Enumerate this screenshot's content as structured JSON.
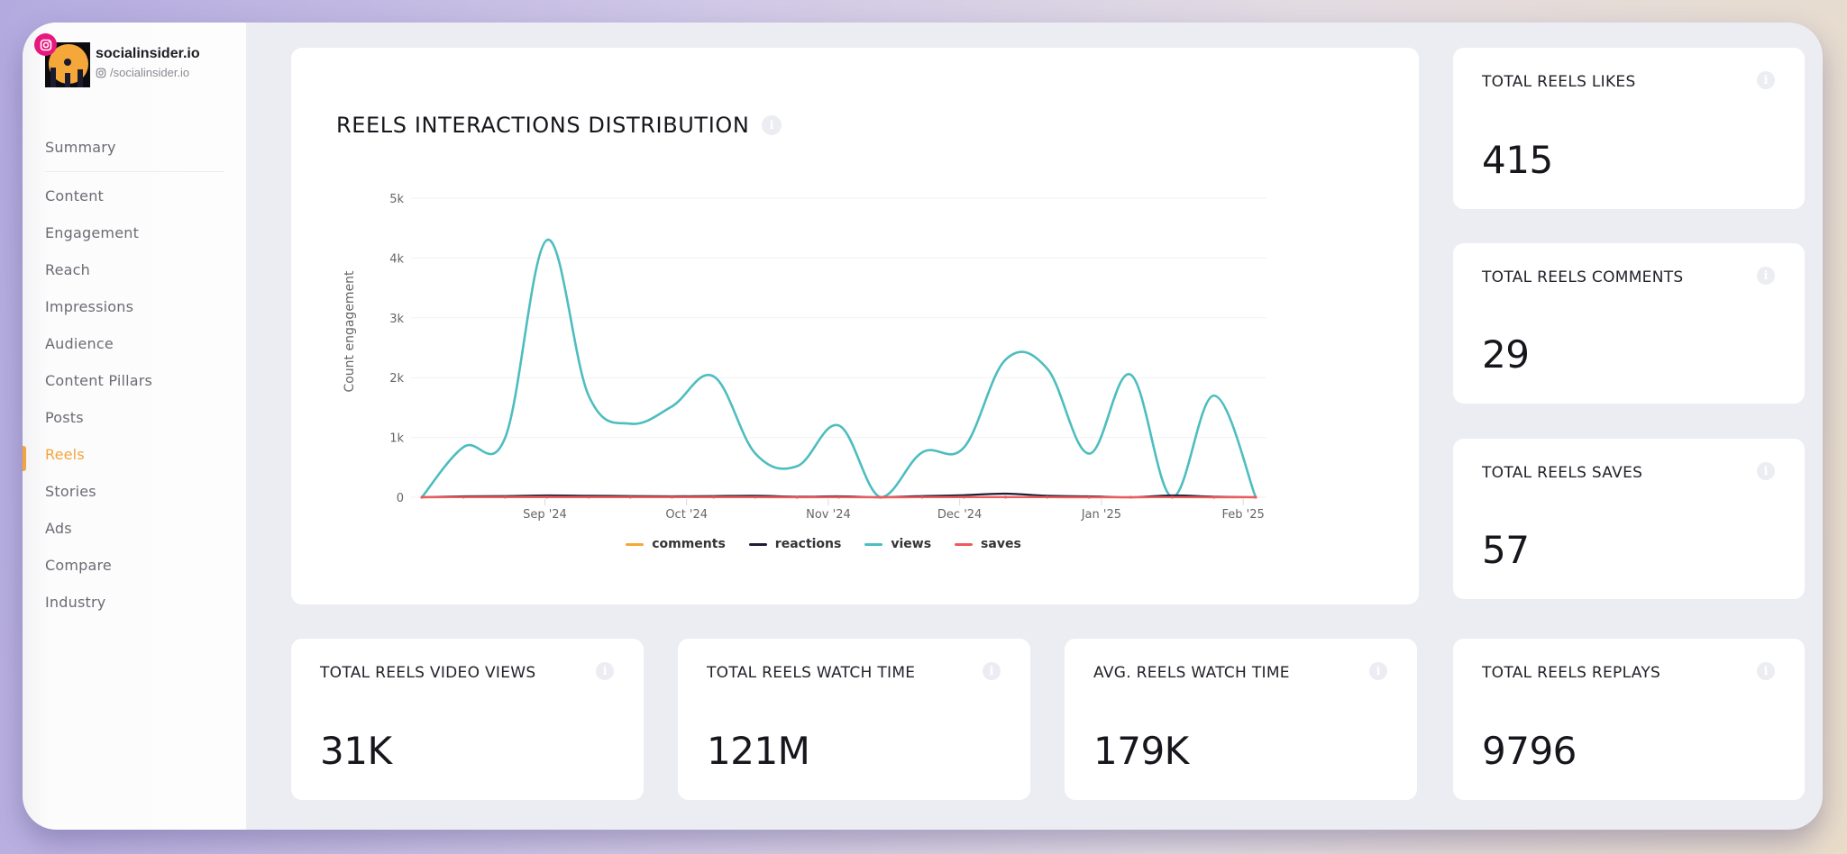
{
  "account": {
    "name": "socialinsider.io",
    "handle": "/socialinsider.io",
    "network_badge": "instagram-icon"
  },
  "sidebar": {
    "items": [
      {
        "label": "Summary",
        "active": false
      },
      {
        "label": "Content",
        "active": false
      },
      {
        "label": "Engagement",
        "active": false
      },
      {
        "label": "Reach",
        "active": false
      },
      {
        "label": "Impressions",
        "active": false
      },
      {
        "label": "Audience",
        "active": false
      },
      {
        "label": "Content Pillars",
        "active": false
      },
      {
        "label": "Posts",
        "active": false
      },
      {
        "label": "Reels",
        "active": true
      },
      {
        "label": "Stories",
        "active": false
      },
      {
        "label": "Ads",
        "active": false
      },
      {
        "label": "Compare",
        "active": false
      },
      {
        "label": "Industry",
        "active": false
      }
    ],
    "active_color": "#f4a43a"
  },
  "chart_card": {
    "title": "REELS INTERACTIONS DISTRIBUTION",
    "info_icon": "info-icon"
  },
  "chart_data": {
    "type": "line",
    "title": "REELS INTERACTIONS DISTRIBUTION",
    "xlabel": "",
    "ylabel": "Count engagement",
    "ylim": [
      0,
      5000
    ],
    "yticks": [
      0,
      1000,
      2000,
      3000,
      4000,
      5000
    ],
    "ytick_labels": [
      "0",
      "1k",
      "2k",
      "3k",
      "4k",
      "5k"
    ],
    "xtick_labels": [
      {
        "label": "Sep '24",
        "index": 2.95
      },
      {
        "label": "Oct '24",
        "index": 6.35
      },
      {
        "label": "Nov '24",
        "index": 9.75
      },
      {
        "label": "Dec '24",
        "index": 12.9
      },
      {
        "label": "Jan '25",
        "index": 16.3
      },
      {
        "label": "Feb '25",
        "index": 19.7
      }
    ],
    "point_count": 21,
    "grid": true,
    "legend_position": "bottom",
    "series": [
      {
        "name": "comments",
        "color": "#f7a733",
        "values": [
          0,
          2,
          3,
          4,
          2,
          2,
          3,
          3,
          2,
          1,
          2,
          0,
          1,
          2,
          3,
          1,
          0,
          0,
          1,
          0,
          2
        ]
      },
      {
        "name": "reactions",
        "color": "#1f1d3a",
        "values": [
          0,
          15,
          20,
          30,
          25,
          20,
          15,
          20,
          25,
          10,
          15,
          0,
          20,
          35,
          60,
          25,
          15,
          0,
          30,
          10,
          0
        ]
      },
      {
        "name": "views",
        "color": "#4dbdbf",
        "values": [
          0,
          840,
          1000,
          4300,
          1700,
          1230,
          1520,
          2020,
          730,
          520,
          1200,
          0,
          750,
          830,
          2300,
          2150,
          730,
          2050,
          0,
          1700,
          0
        ]
      },
      {
        "name": "saves",
        "color": "#ef5a5f",
        "values": [
          0,
          1,
          2,
          2,
          1,
          1,
          2,
          2,
          1,
          0,
          1,
          0,
          1,
          1,
          2,
          1,
          0,
          0,
          1,
          0,
          0
        ]
      }
    ]
  },
  "stat_cards": {
    "likes": {
      "title": "TOTAL REELS LIKES",
      "value": "415"
    },
    "comments": {
      "title": "TOTAL REELS COMMENTS",
      "value": "29"
    },
    "saves": {
      "title": "TOTAL REELS SAVES",
      "value": "57"
    },
    "video_views": {
      "title": "TOTAL REELS VIDEO VIEWS",
      "value": "31K"
    },
    "watch_time": {
      "title": "TOTAL REELS WATCH TIME",
      "value": "121M"
    },
    "avg_watch_time": {
      "title": "AVG. REELS WATCH TIME",
      "value": "179K"
    },
    "replays": {
      "title": "TOTAL REELS REPLAYS",
      "value": "9796"
    }
  },
  "info_icon_glyph": "i"
}
